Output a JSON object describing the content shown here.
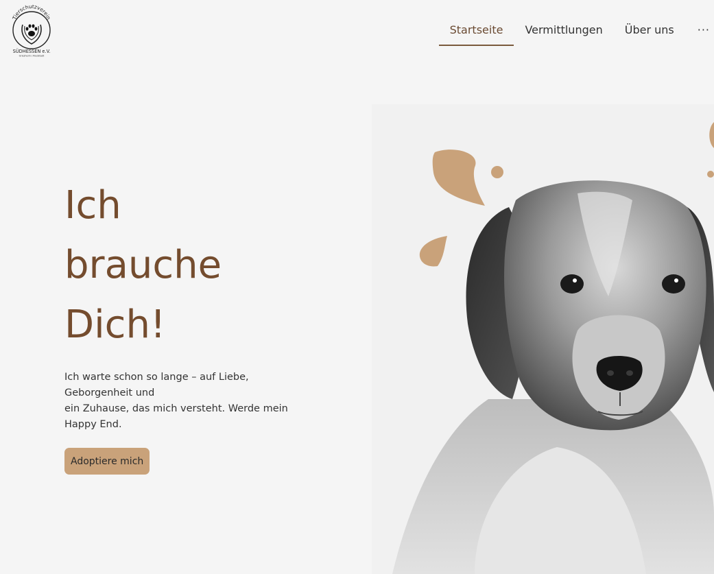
{
  "logo": {
    "arc_text": "Tierschutzverein",
    "name": "SÜDHESSEN e.V.",
    "tagline": "Griesheim / Riedstadt"
  },
  "nav": {
    "items": [
      {
        "label": "Startseite",
        "active": true
      },
      {
        "label": "Vermittlungen",
        "active": false
      },
      {
        "label": "Über uns",
        "active": false
      }
    ],
    "more_label": "···"
  },
  "hero": {
    "title_lines": [
      "Ich",
      "brauche",
      "Dich!"
    ],
    "body_lines": [
      "Ich warte schon so lange – auf Liebe,",
      "Geborgenheit und",
      "ein Zuhause, das mich versteht. Werde mein",
      "Happy End."
    ],
    "cta_label": "Adoptiere mich"
  },
  "photo": {
    "subject": "black-and-white dog portrait",
    "accent_color": "#c9a27a"
  },
  "colors": {
    "background": "#f5f5f5",
    "title": "#744c2e",
    "accent": "#c9a27a",
    "active_nav": "#7a5a3c"
  }
}
